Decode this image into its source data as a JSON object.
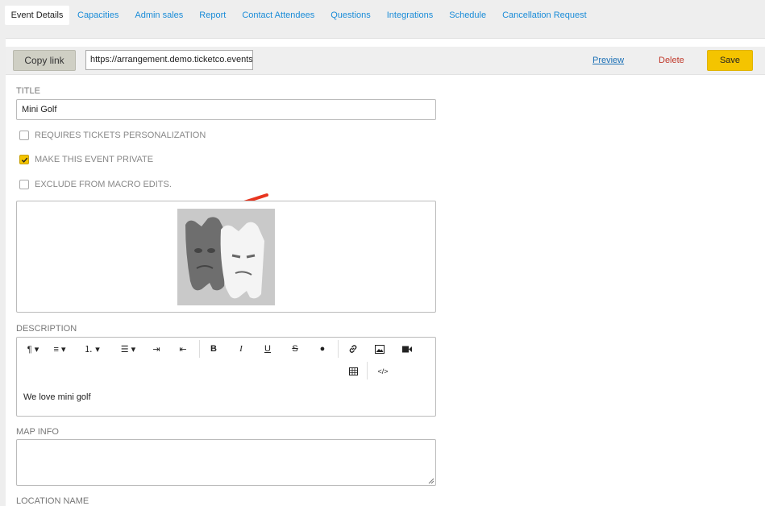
{
  "tabs": [
    "Event Details",
    "Capacities",
    "Admin sales",
    "Report",
    "Contact Attendees",
    "Questions",
    "Integrations",
    "Schedule",
    "Cancellation Request"
  ],
  "toolbar": {
    "copy_link": "Copy link",
    "link_value": "https://arrangement.demo.ticketco.events",
    "preview": "Preview",
    "delete": "Delete",
    "save": "Save"
  },
  "form": {
    "title_label": "TITLE",
    "title_value": "Mini Golf",
    "requires_personalization": "REQUIRES TICKETS PERSONALIZATION",
    "make_private": "MAKE THIS EVENT PRIVATE",
    "exclude_macro": "EXCLUDE FROM MACRO EDITS.",
    "description_label": "DESCRIPTION",
    "description_text": "We love mini golf",
    "map_info_label": "MAP INFO",
    "location_name_label": "LOCATION NAME"
  },
  "colors": {
    "accent": "#f4c400",
    "link": "#1a8cd8",
    "delete": "#c0392b",
    "arrow": "#e8351f"
  }
}
